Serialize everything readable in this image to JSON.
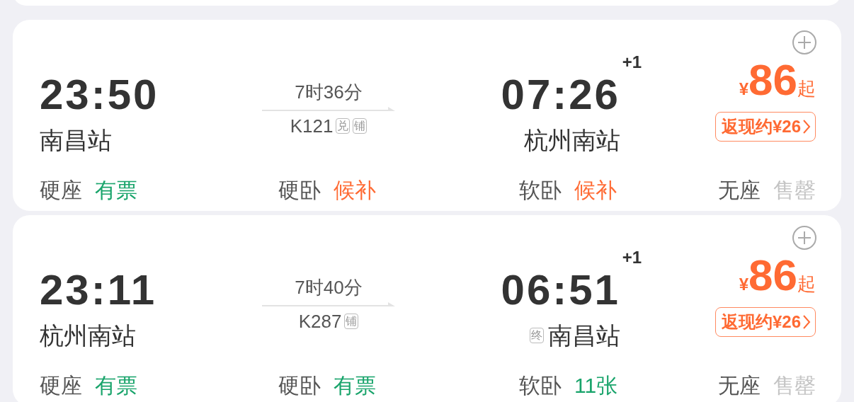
{
  "trains": [
    {
      "depart": {
        "time": "23:50",
        "station": "南昌站"
      },
      "duration": "7时36分",
      "train_no": "K121",
      "tags": [
        "兑",
        "铺"
      ],
      "arrive": {
        "time": "07:26",
        "day_offset": "+1",
        "station": "杭州南站"
      },
      "price": {
        "currency": "¥",
        "amount": "86",
        "suffix": "起"
      },
      "cashback": "返现约¥26",
      "seats": [
        {
          "class": "硬座",
          "status": "有票",
          "kind": "available"
        },
        {
          "class": "硬卧",
          "status": "候补",
          "kind": "waitlist"
        },
        {
          "class": "软卧",
          "status": "候补",
          "kind": "waitlist"
        },
        {
          "class": "无座",
          "status": "售罄",
          "kind": "soldout"
        }
      ]
    },
    {
      "depart": {
        "time": "23:11",
        "station": "杭州南站"
      },
      "duration": "7时40分",
      "train_no": "K287",
      "tags": [
        "铺"
      ],
      "arrive": {
        "time": "06:51",
        "day_offset": "+1",
        "station": "南昌站",
        "tag": "终"
      },
      "price": {
        "currency": "¥",
        "amount": "86",
        "suffix": "起"
      },
      "cashback": "返现约¥26",
      "seats": [
        {
          "class": "硬座",
          "status": "有票",
          "kind": "available"
        },
        {
          "class": "硬卧",
          "status": "有票",
          "kind": "available"
        },
        {
          "class": "软卧",
          "status": "11张",
          "kind": "available"
        },
        {
          "class": "无座",
          "status": "售罄",
          "kind": "soldout"
        }
      ]
    }
  ]
}
